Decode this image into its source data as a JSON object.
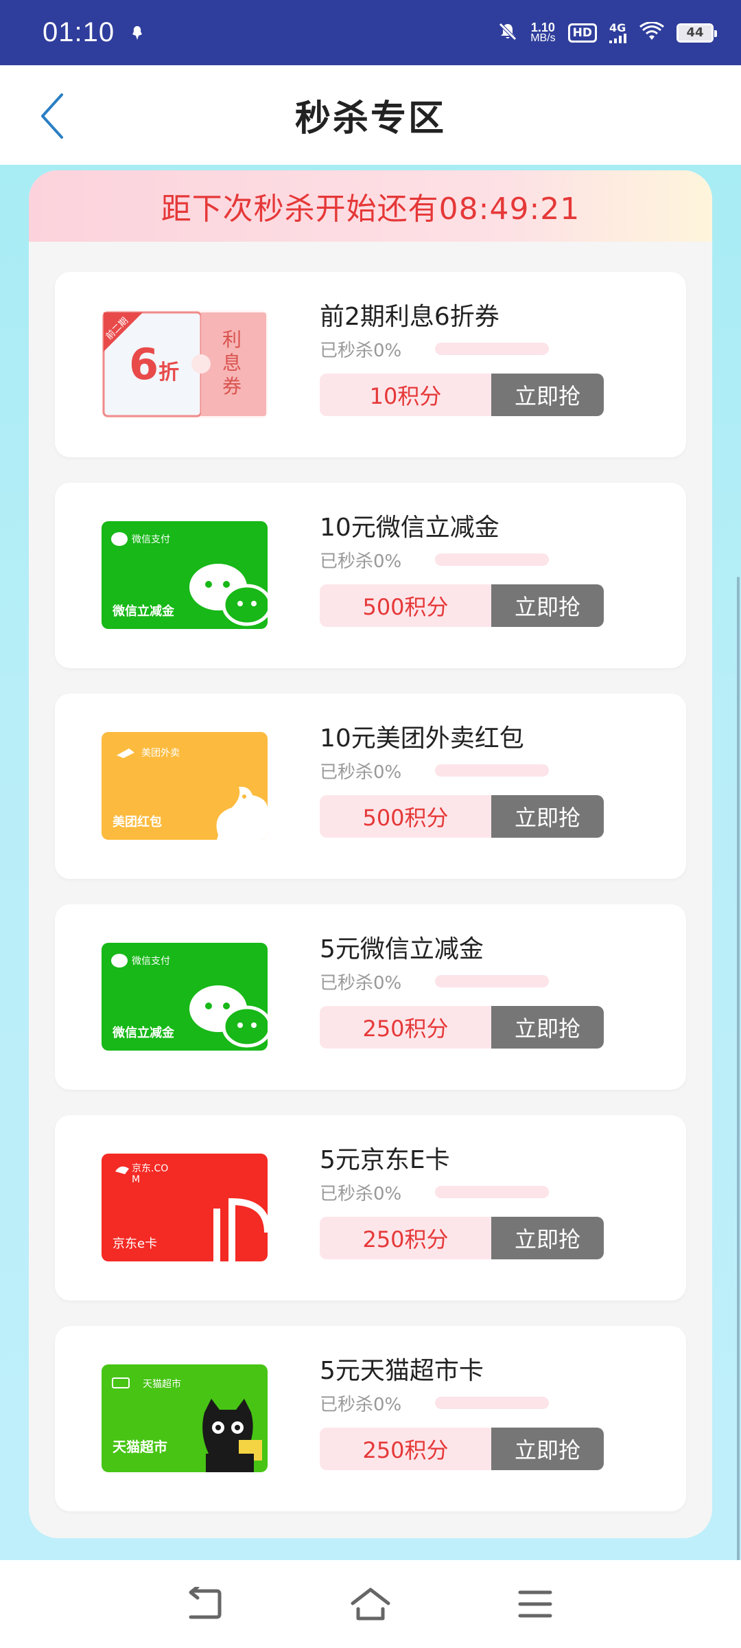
{
  "status_bar": {
    "time": "01:10",
    "net_speed_value": "1.10",
    "net_speed_unit": "MB/s",
    "hd": "HD",
    "network": "4G",
    "battery": "44"
  },
  "header": {
    "title": "秒杀专区"
  },
  "countdown": {
    "text": "距下次秒杀开始还有08:49:21"
  },
  "items": [
    {
      "title": "前2期利息6折券",
      "sold": "已秒杀0%",
      "sold_fraction": 0,
      "price": "10积分",
      "button": "立即抢",
      "thumb": "coupon",
      "thumb_text": {
        "discount": "6",
        "discount_unit": "折",
        "tag": "前二期",
        "side": "利息券"
      }
    },
    {
      "title": "10元微信立减金",
      "sold": "已秒杀0%",
      "sold_fraction": 0,
      "price": "500积分",
      "button": "立即抢",
      "thumb": "wechat",
      "thumb_text": {
        "logo": "微信支付",
        "label": "微信立减金"
      }
    },
    {
      "title": "10元美团外卖红包",
      "sold": "已秒杀0%",
      "sold_fraction": 0,
      "price": "500积分",
      "button": "立即抢",
      "thumb": "meituan",
      "thumb_text": {
        "logo": "美团外卖",
        "label": "美团红包"
      }
    },
    {
      "title": "5元微信立减金",
      "sold": "已秒杀0%",
      "sold_fraction": 0,
      "price": "250积分",
      "button": "立即抢",
      "thumb": "wechat",
      "thumb_text": {
        "logo": "微信支付",
        "label": "微信立减金"
      }
    },
    {
      "title": "5元京东E卡",
      "sold": "已秒杀0%",
      "sold_fraction": 0,
      "price": "250积分",
      "button": "立即抢",
      "thumb": "jd",
      "thumb_text": {
        "logo": "京东.COM",
        "label": "京东e卡"
      }
    },
    {
      "title": "5元天猫超市卡",
      "sold": "已秒杀0%",
      "sold_fraction": 0,
      "price": "250积分",
      "button": "立即抢",
      "thumb": "tmall",
      "thumb_text": {
        "logo": "天猫超市",
        "label": "天猫超市"
      }
    }
  ],
  "colors": {
    "status_bar": "#2f3e9c",
    "accent_red": "#e53838",
    "button_gray": "#767676",
    "back_arrow": "#2a7fc4"
  },
  "icons": [
    "back-arrow-icon",
    "nav-back-icon",
    "nav-home-icon",
    "nav-menu-icon"
  ]
}
